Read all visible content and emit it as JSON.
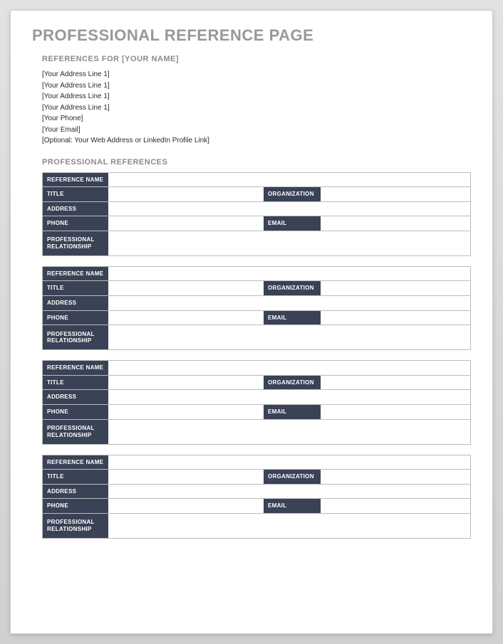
{
  "title": "PROFESSIONAL REFERENCE PAGE",
  "refs_for": "REFERENCES FOR [YOUR NAME]",
  "contact": [
    "[Your Address Line 1]",
    "[Your Address Line 1]",
    "[Your Address Line 1]",
    "[Your Address Line 1]",
    "[Your Phone]",
    "[Your Email]",
    "[Optional: Your Web Address or LinkedIn Profile Link]"
  ],
  "section": "PROFESSIONAL REFERENCES",
  "labels": {
    "ref_name": "REFERENCE NAME",
    "title": "TITLE",
    "organization": "ORGANIZATION",
    "address": "ADDRESS",
    "phone": "PHONE",
    "email": "EMAIL",
    "relationship": "PROFESSIONAL RELATIONSHIP"
  }
}
